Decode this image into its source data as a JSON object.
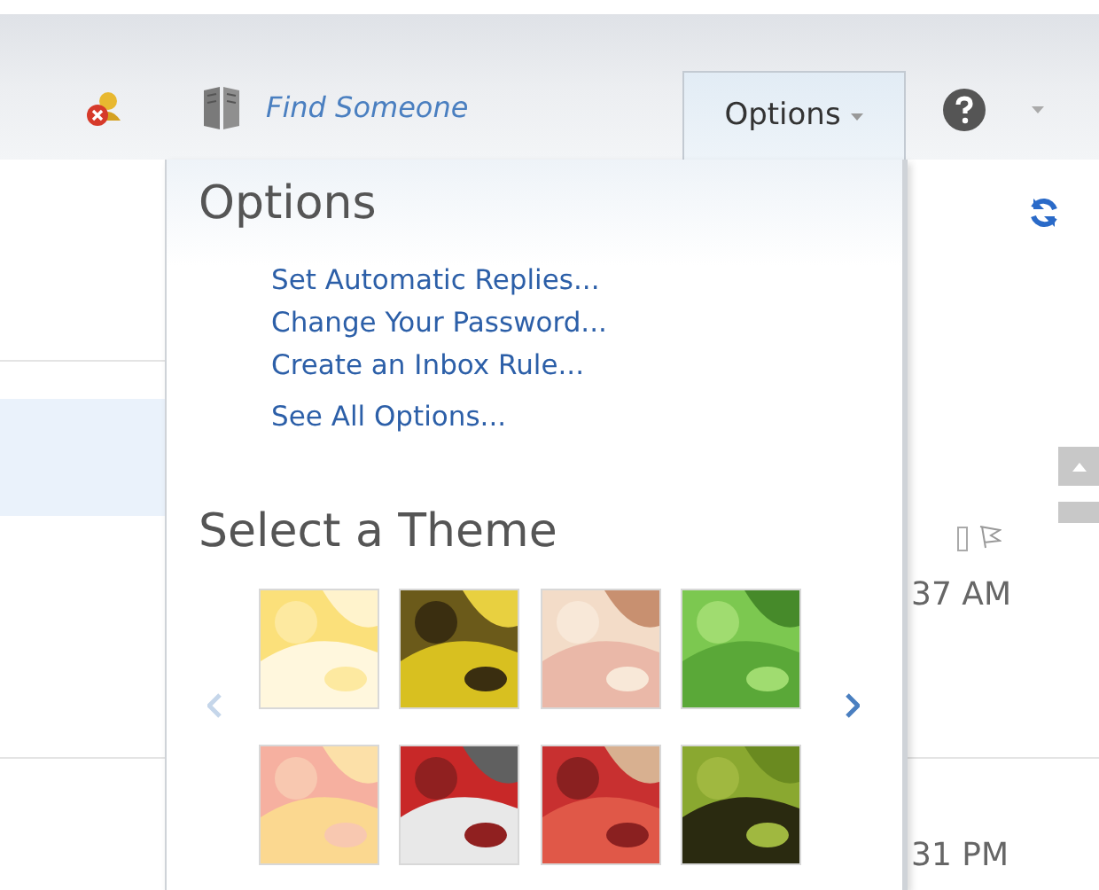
{
  "toolbar": {
    "find_someone": "Find Someone",
    "options_button": {
      "label": "Options",
      "expanded": true
    }
  },
  "options_menu": {
    "title": "Options",
    "links": [
      "Set Automatic Replies...",
      "Change Your Password...",
      "Create an Inbox Rule...",
      "See All Options..."
    ],
    "theme_heading": "Select a Theme"
  },
  "message_times": [
    "37 AM",
    "31 PM"
  ]
}
